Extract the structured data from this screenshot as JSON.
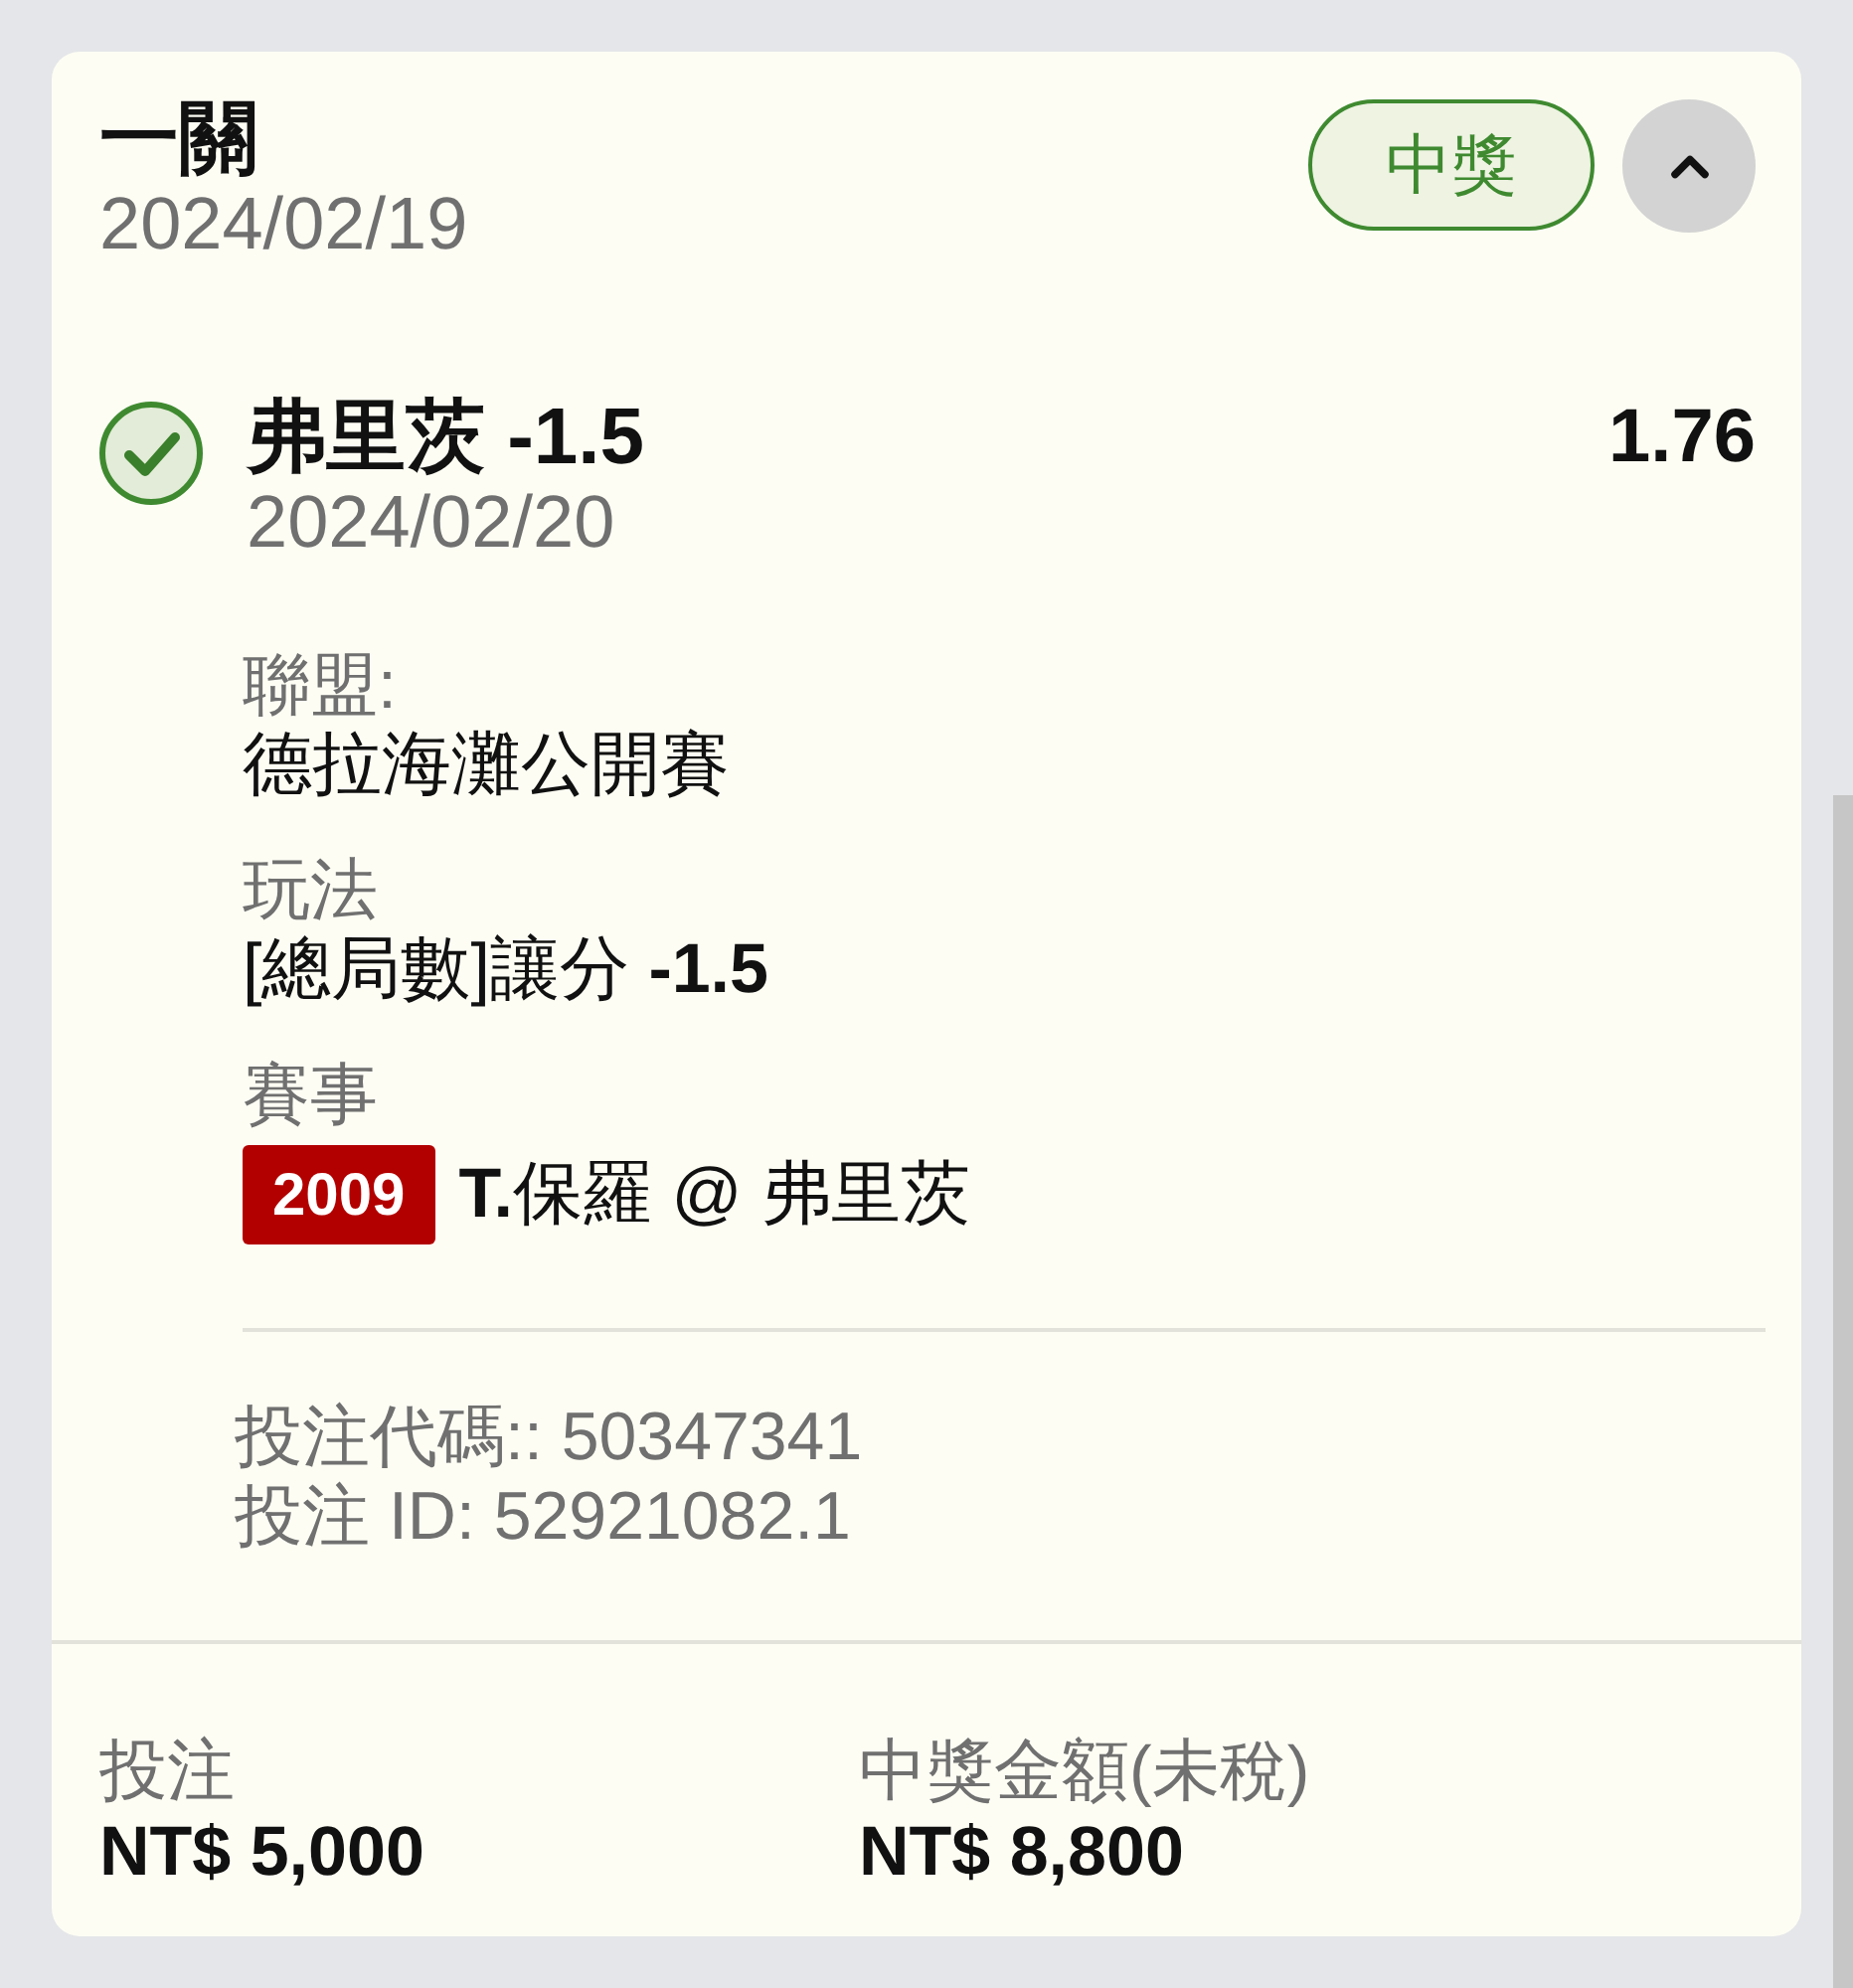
{
  "bet": {
    "title": "一關",
    "date": "2024/02/19",
    "status": "中獎",
    "expanded": true
  },
  "selection": {
    "won": true,
    "pick": "弗里茨 -1.5",
    "odds": "1.76",
    "date": "2024/02/20"
  },
  "details": [
    {
      "label": "聯盟:",
      "value": "德拉海灘公開賽"
    },
    {
      "label": "玩法",
      "value": "[總局數]讓分 **-1.5**"
    },
    {
      "label": "賽事",
      "event_code": "2009",
      "value": "**T.**保羅 @ 弗里茨"
    }
  ],
  "ids": [
    "投注代碼:: 50347341",
    "投注 ID: 52921082.1"
  ],
  "totals": [
    {
      "label": "投注",
      "amount": "NT$ 5,000"
    },
    {
      "label": "中獎金額(未稅)",
      "amount": "NT$ 8,800"
    }
  ]
}
